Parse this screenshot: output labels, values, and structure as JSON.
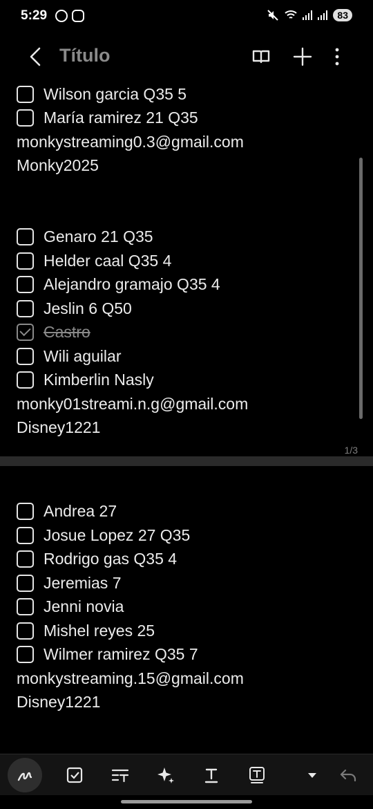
{
  "status_bar": {
    "time": "5:29",
    "battery": "83"
  },
  "header": {
    "title": "Título"
  },
  "lines": [
    {
      "type": "check",
      "checked": false,
      "text": "Wilson garcia Q35 5"
    },
    {
      "type": "check",
      "checked": false,
      "text": "María ramirez 21 Q35"
    },
    {
      "type": "text",
      "text": "monkystreaming0.3@gmail.com"
    },
    {
      "type": "text",
      "text": "Monky2025"
    },
    {
      "type": "check",
      "checked": false,
      "text": "Genaro 21 Q35"
    },
    {
      "type": "check",
      "checked": false,
      "text": "Helder caal Q35 4"
    },
    {
      "type": "check",
      "checked": false,
      "text": "Alejandro  gramajo Q35 4"
    },
    {
      "type": "check",
      "checked": false,
      "text": "Jeslin 6 Q50"
    },
    {
      "type": "check",
      "checked": true,
      "text": "Castro"
    },
    {
      "type": "check",
      "checked": false,
      "text": "Wili aguilar"
    },
    {
      "type": "check",
      "checked": false,
      "text": "Kimberlin Nasly"
    },
    {
      "type": "text",
      "text": "monky01streami.n.g@gmail.com"
    },
    {
      "type": "text",
      "text": "Disney1221"
    },
    {
      "type": "check",
      "checked": false,
      "text": "Andrea 27"
    },
    {
      "type": "check",
      "checked": false,
      "text": "Josue Lopez 27 Q35"
    },
    {
      "type": "check",
      "checked": false,
      "text": "Rodrigo  gas Q35 4"
    },
    {
      "type": "check",
      "checked": false,
      "text": "Jeremias 7"
    },
    {
      "type": "check",
      "checked": false,
      "text": "Jenni novia"
    },
    {
      "type": "check",
      "checked": false,
      "text": "Mishel  reyes 25"
    },
    {
      "type": "check",
      "checked": false,
      "text": "Wilmer ramirez Q35 7"
    },
    {
      "type": "text",
      "text": "monkystreaming.15@gmail.com"
    },
    {
      "type": "text",
      "text": "Disney1221"
    }
  ],
  "page_indicator": "1/3",
  "toolbar": {
    "icons": [
      "pen-icon",
      "checkbox-icon",
      "text-format-icon",
      "sparkle-icon",
      "underline-text-icon",
      "text-box-icon",
      "dropdown-arrow-icon",
      "undo-icon"
    ]
  }
}
